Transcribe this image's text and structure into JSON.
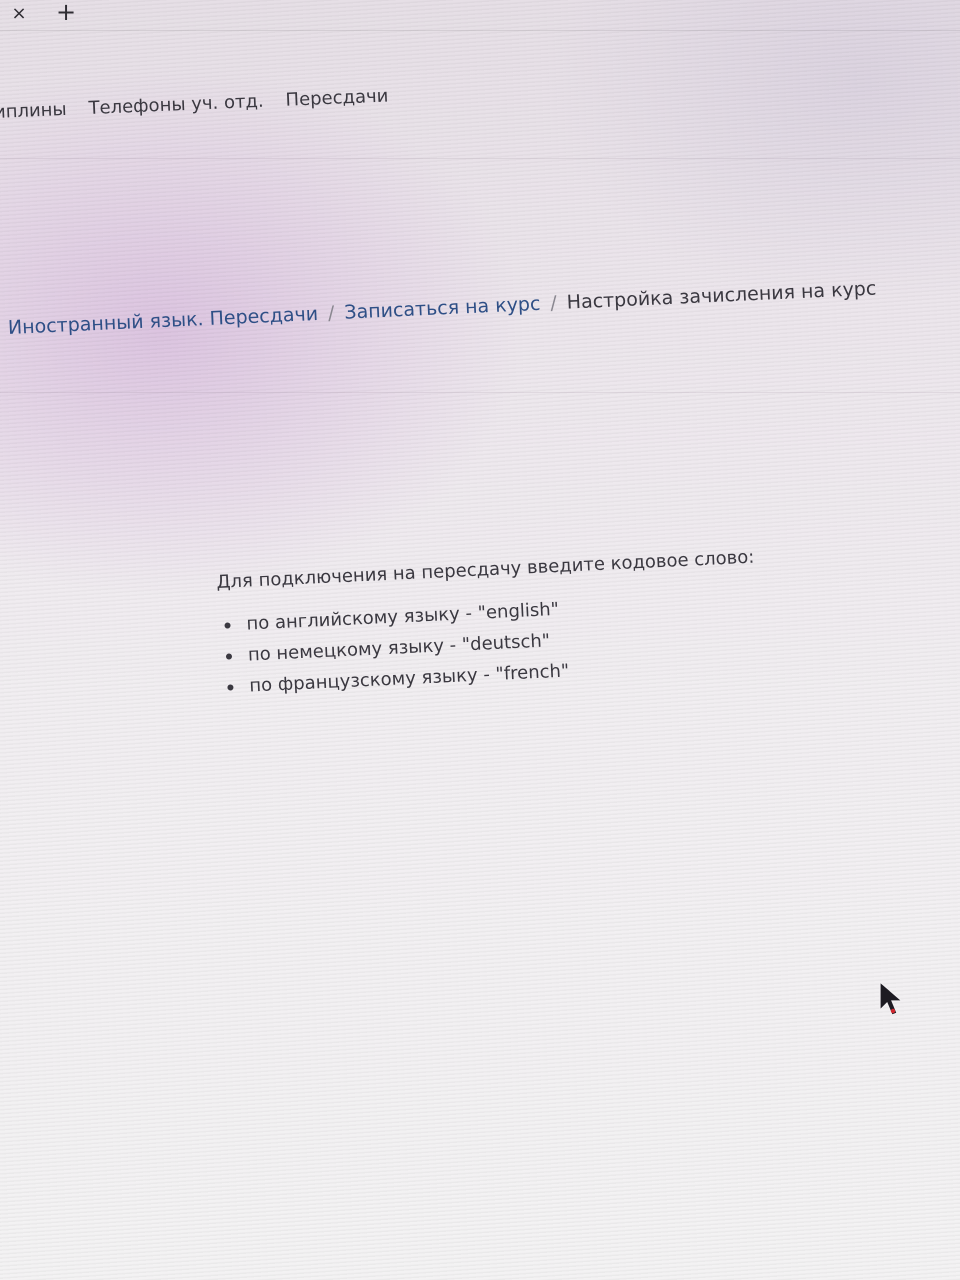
{
  "tabbar": {
    "close_symbol": "×",
    "new_tab_symbol": "+"
  },
  "topnav": {
    "items": [
      {
        "label": "иплины"
      },
      {
        "label": "Телефоны уч. отд."
      },
      {
        "label": "Пересдачи"
      }
    ]
  },
  "breadcrumb": {
    "items": [
      {
        "label": "Иностранный язык. Пересдачи"
      },
      {
        "label": "Записаться на курс"
      },
      {
        "label": "Настройка зачисления на курс"
      }
    ],
    "separator": "/"
  },
  "content": {
    "intro": "Для подключения на пересдачу введите кодовое слово:",
    "items": [
      {
        "text": "по английскому языку - \"english\""
      },
      {
        "text": "по немецкому языку - \"deutsch\""
      },
      {
        "text": "по французскому языку - \"french\""
      }
    ]
  },
  "colors": {
    "link": "#2e4f86",
    "text": "#3a3840"
  }
}
